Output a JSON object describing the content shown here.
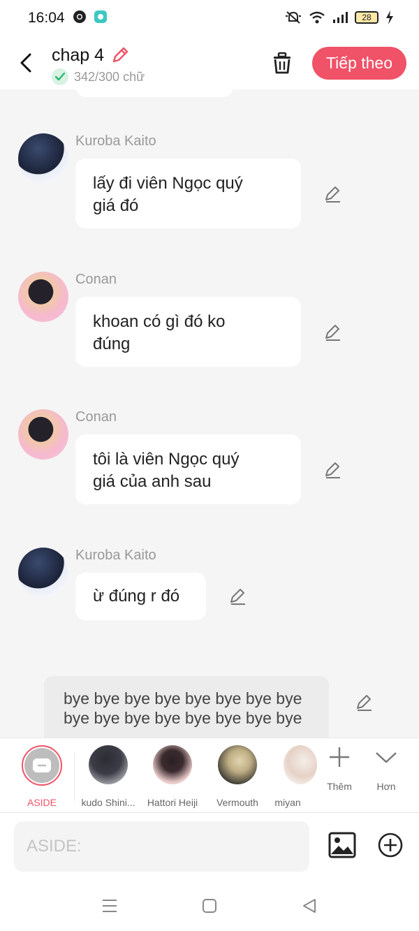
{
  "status": {
    "time": "16:04",
    "battery": "28"
  },
  "header": {
    "title": "chap 4",
    "word_count": "342/300 chữ",
    "next_label": "Tiếp theo"
  },
  "messages": [
    {
      "sender": "Kuroba Kaito",
      "text_line1": "lấy đi viên Ngọc quý",
      "text_line2": "giá đó"
    },
    {
      "sender": "Conan",
      "text_line1": "khoan có gì đó ko",
      "text_line2": "đúng"
    },
    {
      "sender": "Conan",
      "text_line1": "tôi là viên Ngọc quý",
      "text_line2": "giá của anh sau"
    },
    {
      "sender": "Kuroba Kaito",
      "text_line1": "ừ đúng r đó"
    }
  ],
  "aside": {
    "line1": "bye bye bye bye bye bye bye bye",
    "line2": "bye bye bye bye bye bye bye bye"
  },
  "characters": [
    {
      "name": "ASIDE"
    },
    {
      "name": "kudo Shini..."
    },
    {
      "name": "Hattori Heiji"
    },
    {
      "name": "Vermouth"
    },
    {
      "name": "miyan"
    }
  ],
  "tools": {
    "more_label": "Thêm",
    "less_label": "Hơn"
  },
  "input": {
    "placeholder": "ASIDE:"
  },
  "colors": {
    "accent": "#f05267",
    "background": "#f5f5f5",
    "bubble": "#ffffff",
    "aside_bubble": "#ececec"
  }
}
